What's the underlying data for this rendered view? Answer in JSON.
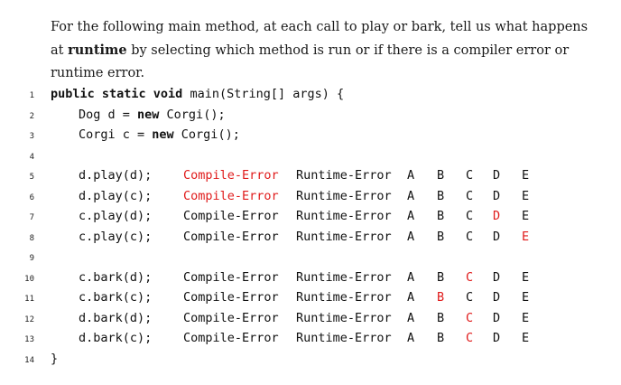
{
  "question": {
    "part1": "For the following main method, at each call to play or bark, tell us what happens at",
    "bold": "runtime",
    "part2": " by selecting which method is run or if there is a compiler error or runtime error."
  },
  "code": {
    "line_numbers": [
      "1",
      "2",
      "3",
      "4",
      "5",
      "6",
      "7",
      "8",
      "9",
      "10",
      "11",
      "12",
      "13",
      "14"
    ],
    "header": {
      "kw": "public static void",
      "rest": " main(String[] args) {"
    },
    "decl1": {
      "type": "Dog d = ",
      "kw": "new",
      "rest": " Corgi();"
    },
    "decl2": {
      "type": "Corgi c = ",
      "kw": "new",
      "rest": " Corgi();"
    },
    "closing": "}"
  },
  "options": {
    "compile_error": "Compile-Error",
    "runtime_error": "Runtime-Error",
    "letters": [
      "A",
      "B",
      "C",
      "D",
      "E"
    ]
  },
  "rows": [
    {
      "call": "d.play(d);",
      "selected": "Compile-Error"
    },
    {
      "call": "d.play(c);",
      "selected": "Compile-Error"
    },
    {
      "call": "c.play(d);",
      "selected": "D"
    },
    {
      "call": "c.play(c);",
      "selected": "E"
    },
    {
      "call": "c.bark(d);",
      "selected": "C"
    },
    {
      "call": "c.bark(c);",
      "selected": "B"
    },
    {
      "call": "d.bark(d);",
      "selected": "C"
    },
    {
      "call": "d.bark(c);",
      "selected": "C"
    }
  ],
  "colors": {
    "selected": "#e01b1b",
    "text": "#111111"
  }
}
